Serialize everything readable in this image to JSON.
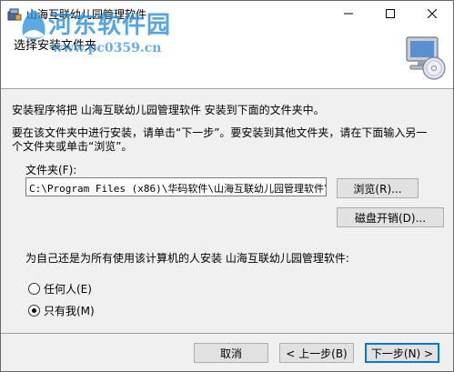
{
  "window": {
    "title": "山海互联幼儿园管理软件"
  },
  "watermark": {
    "name": "河东软件园",
    "url": "www.pc0359.cn"
  },
  "header": {
    "title": "选择安装文件夹"
  },
  "body": {
    "intro": "安装程序将把 山海互联幼儿园管理软件 安装到下面的文件夹中。",
    "instruction_line1": "要在该文件夹中进行安装，请单击“下一步”。要安装到其他文件夹，请在下面输入另一",
    "instruction_line2": "个文件夹或单击“浏览”。",
    "folder_label": "文件夹(F):",
    "folder_value": "C:\\Program Files (x86)\\华码软件\\山海互联幼儿园管理软件\\",
    "browse_label": "浏览(R)...",
    "disk_cost_label": "磁盘开销(D)...",
    "install_for_prompt": "为自己还是为所有使用该计算机的人安装 山海互联幼儿园管理软件:",
    "radio_everyone": "任何人(E)",
    "radio_just_me": "只有我(M)",
    "selected_option": "只有我(M)"
  },
  "footer": {
    "cancel_label": "取消",
    "back_label": "< 上一步(B)",
    "next_label": "下一步(N) >"
  },
  "colors": {
    "accent": "#0078d7",
    "watermark": "#288cd7",
    "panel": "#f0f0f0"
  }
}
